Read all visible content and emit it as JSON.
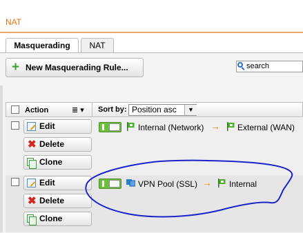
{
  "header": {
    "title": "NAT"
  },
  "tabs": [
    {
      "label": "Masquerading",
      "active": true
    },
    {
      "label": "NAT",
      "active": false
    }
  ],
  "toolbar": {
    "new_rule_label": "New Masquerading Rule...",
    "search_placeholder": "search"
  },
  "table": {
    "action_label": "Action",
    "sort_label": "Sort by:",
    "sort_value": "Position asc",
    "rows": [
      {
        "edit": "Edit",
        "delete": "Delete",
        "clone": "Clone",
        "source": "Internal (Network)",
        "target": "External (WAN)",
        "enabled": true
      },
      {
        "edit": "Edit",
        "delete": "Delete",
        "clone": "Clone",
        "source": "VPN Pool (SSL)",
        "target": "Internal",
        "enabled": true
      }
    ]
  },
  "colors": {
    "accent": "#e8720c",
    "toggle_on": "#6dc13a",
    "annotation": "#1a22c8"
  }
}
